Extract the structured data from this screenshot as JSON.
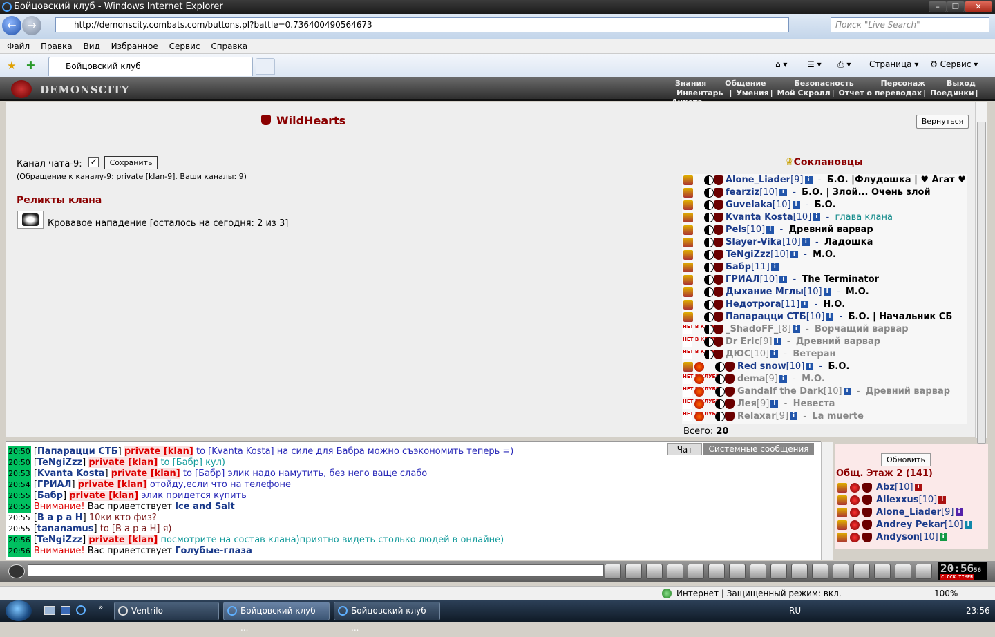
{
  "window": {
    "title": "Бойцовский клуб - Windows Internet Explorer",
    "url": "http://demonscity.combats.com/buttons.pl?battle=0.736400490564673",
    "search_placeholder": "Поиск \"Live Search\"",
    "tab_title": "Бойцовский клуб",
    "menu": [
      "Файл",
      "Правка",
      "Вид",
      "Избранное",
      "Сервис",
      "Справка"
    ],
    "cmd_page": "Страница",
    "cmd_tools": "Сервис"
  },
  "game_header": {
    "logo": "DEMONSCITY",
    "nav_top": [
      "Знания",
      "Общение",
      "Безопасность",
      "Персонаж",
      "Выход"
    ],
    "nav_bottom": [
      "Инвентарь",
      "Умения",
      "Мой Скролл",
      "Отчет о переводах",
      "Поединки",
      "Анкета"
    ]
  },
  "clan": {
    "name": "WildHearts",
    "back_label": "Вернуться",
    "channel_label": "Канал чата-9:",
    "channel_checked": "✓",
    "save_label": "Сохранить",
    "channel_info": "(Обращение к каналу-9: private [klan-9]. Ваши каналы: 9)",
    "relics_title": "Реликты клана",
    "relic_text": "Кровавое нападение [осталось на сегодня: 2 из 3]",
    "members_title": "Соклановцы",
    "total_label": "Всего:",
    "total_value": "20",
    "members": [
      {
        "name": "Alone_Liader",
        "level": "[9]",
        "status": "Б.О. |Флудошка | ♥ Агат ♥",
        "online": true
      },
      {
        "name": "fearziz",
        "level": "[10]",
        "status": "Б.О. | Злой... Очень злой",
        "online": true
      },
      {
        "name": "Guvelaka",
        "level": "[10]",
        "status": "Б.О.",
        "online": true
      },
      {
        "name": "Kvanta Kosta",
        "level": "[10]",
        "status": "глава клана",
        "online": true,
        "status_color": "#118a8a"
      },
      {
        "name": "Pels",
        "level": "[10]",
        "status": "Древний варвар",
        "online": true
      },
      {
        "name": "Slayer-Vika",
        "level": "[10]",
        "status": "Ладошка",
        "online": true
      },
      {
        "name": "TeNgiZzz",
        "level": "[10]",
        "status": "М.О.",
        "online": true
      },
      {
        "name": "Бабр",
        "level": "[11]",
        "status": "",
        "online": true
      },
      {
        "name": "ГРИАЛ",
        "level": "[10]",
        "status": "The Terminator",
        "online": true
      },
      {
        "name": "Дыхание Мглы",
        "level": "[10]",
        "status": "М.О.",
        "online": true
      },
      {
        "name": "Недотрога",
        "level": "[11]",
        "status": "Н.О.",
        "online": true
      },
      {
        "name": "Папарацци СТБ",
        "level": "[10]",
        "status": "Б.О. | Начальник СБ",
        "online": true
      },
      {
        "name": "_ShadoFF_",
        "level": "[8]",
        "status": "Ворчащий варвар",
        "online": false
      },
      {
        "name": "Dr Eric",
        "level": "[9]",
        "status": "Древний варвар",
        "online": false
      },
      {
        "name": "ДЮС",
        "level": "[10]",
        "status": "Ветеран",
        "online": false
      },
      {
        "name": "Red snow",
        "level": "[10]",
        "status": "Б.О.",
        "online": true,
        "shift": true
      },
      {
        "name": "dema",
        "level": "[9]",
        "status": "М.О.",
        "online": false,
        "shift": true
      },
      {
        "name": "Gandalf the Dark",
        "level": "[10]",
        "status": "Древний варвар",
        "online": false,
        "shift": true
      },
      {
        "name": "Лея",
        "level": "[9]",
        "status": "Невеста",
        "online": false,
        "shift": true
      },
      {
        "name": "Relaxar",
        "level": "[9]",
        "status": "La muerte",
        "online": false,
        "shift": true
      }
    ],
    "no_clan_badge": "НЕТ В КЛУБЕ"
  },
  "chat": {
    "tab_chat": "Чат",
    "tab_system": "Системные сообщения",
    "lines": [
      {
        "ts": "20:50",
        "hl": true,
        "nick": "Папарацци СТБ",
        "priv": "private [klan]",
        "text": "to [Kvanta Kosta] на силе для Бабра можно съэкономить теперь =)",
        "cls": "msg-blue"
      },
      {
        "ts": "20:50",
        "hl": true,
        "nick": "TeNgiZzz",
        "priv": "private [klan]",
        "text": "to [Бабр] кул)",
        "cls": "msg-green"
      },
      {
        "ts": "20:53",
        "hl": true,
        "nick": "Kvanta Kosta",
        "priv": "private [klan]",
        "text": "to [Бабр] элик надо намутить, без него ваще слабо",
        "cls": "msg-blue"
      },
      {
        "ts": "20:54",
        "hl": true,
        "nick": "ГРИАЛ",
        "priv": "private [klan]",
        "text": "отойду,если что на телефоне",
        "cls": "msg-blue"
      },
      {
        "ts": "20:55",
        "hl": true,
        "nick": "Бабр",
        "priv": "private [klan]",
        "text": "элик придется купить",
        "cls": "msg-blue"
      },
      {
        "ts": "20:55",
        "hl": true,
        "warn": "Внимание!",
        "text": "Вас приветствует",
        "bold": "Ice and Salt"
      },
      {
        "ts": "20:55",
        "hl": false,
        "nick": "В а р а Н",
        "text": "10ки кто физ?",
        "cls": "msg-dark"
      },
      {
        "ts": "20:55",
        "hl": false,
        "nick": "tananamus",
        "text": "to [В а р а Н] я)",
        "cls": "msg-dark"
      },
      {
        "ts": "20:56",
        "hl": true,
        "nick": "TeNgiZzz",
        "priv": "private [klan]",
        "text": "посмотрите на состав клана)приятно видеть столько людей в онлайне)",
        "cls": "msg-green"
      },
      {
        "ts": "20:56",
        "hl": true,
        "warn": "Внимание!",
        "text": "Вас приветствует",
        "bold": "Голубые-глаза"
      }
    ]
  },
  "online": {
    "refresh_label": "Обновить",
    "floor_label": "Общ. Этаж 2 (141)",
    "users": [
      {
        "name": "Abz",
        "level": "[10]",
        "info_color": "#aa1111"
      },
      {
        "name": "Allexxus",
        "level": "[10]",
        "info_color": "#aa1111"
      },
      {
        "name": "Alone_Liader",
        "level": "[9]",
        "info_color": "#5522aa"
      },
      {
        "name": "Andrey Pekar",
        "level": "[10]",
        "info_color": "#1188aa"
      },
      {
        "name": "Andyson",
        "level": "[10]",
        "info_color": "#119944"
      }
    ]
  },
  "clock": {
    "time": "20:56",
    "seconds": "56",
    "label": "CLOCK TIMER"
  },
  "statusbar": {
    "zone": "Интернет | Защищенный режим: вкл.",
    "zoom": "100%"
  },
  "taskbar": {
    "tasks": [
      "Ventrilo",
      "Бойцовский клуб - ...",
      "Бойцовский клуб - ..."
    ],
    "lang": "RU",
    "time": "23:56"
  }
}
